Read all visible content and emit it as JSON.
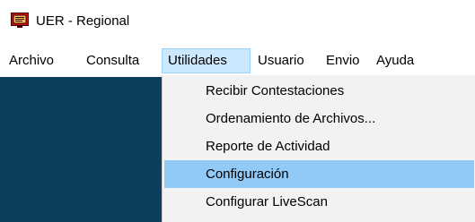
{
  "window": {
    "title": "UER - Regional",
    "icon": "monitor-app-icon"
  },
  "menubar": {
    "items": [
      {
        "label": "Archivo"
      },
      {
        "label": "Consulta"
      },
      {
        "label": "Utilidades",
        "active": true
      },
      {
        "label": "Usuario"
      },
      {
        "label": "Envio"
      },
      {
        "label": "Ayuda"
      }
    ]
  },
  "dropdown": {
    "items": [
      {
        "label": "Recibir Contestaciones"
      },
      {
        "label": "Ordenamiento de Archivos..."
      },
      {
        "label": "Reporte de Actividad"
      },
      {
        "label": "Configuración",
        "highlighted": true
      },
      {
        "label": "Configurar LiveScan"
      }
    ]
  },
  "colors": {
    "client_background": "#0e3e5e",
    "active_menu": "#cce8ff",
    "highlighted_item": "#91c9f7",
    "icon_red": "#d01010"
  }
}
